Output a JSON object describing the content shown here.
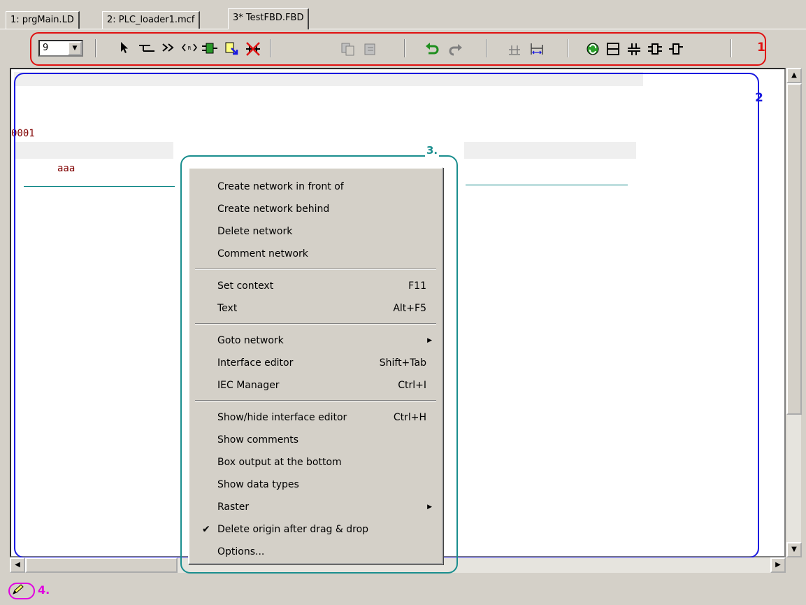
{
  "tabs": [
    {
      "label": "1: prgMain.LD"
    },
    {
      "label": "2: PLC_loader1.mcf"
    },
    {
      "label": "3* TestFBD.FBD"
    }
  ],
  "toolbar": {
    "zoom_value": "9",
    "tools": [
      "pointer-icon",
      "contact-icon",
      "jump-icon",
      "return-icon",
      "function-block-icon",
      "insert-block-icon",
      "delete-connection-icon",
      "copy-network-icon",
      "paste-network-icon",
      "undo-icon",
      "redo-icon",
      "align-icon",
      "distribute-icon",
      "refresh-icon",
      "panel-icon",
      "parallel-icon",
      "block-io-icon",
      "block-out-icon"
    ]
  },
  "editor": {
    "network_number": "0001",
    "variable_name": "aaa"
  },
  "context_menu": {
    "groups": [
      [
        {
          "label": "Create network in front of"
        },
        {
          "label": "Create network behind"
        },
        {
          "label": "Delete network"
        },
        {
          "label": "Comment network"
        }
      ],
      [
        {
          "label": "Set context",
          "shortcut": "F11"
        },
        {
          "label": "Text",
          "shortcut": "Alt+F5"
        }
      ],
      [
        {
          "label": "Goto network",
          "submenu": true
        },
        {
          "label": "Interface editor",
          "shortcut": "Shift+Tab"
        },
        {
          "label": "IEC Manager",
          "shortcut": "Ctrl+I"
        }
      ],
      [
        {
          "label": "Show/hide interface editor",
          "shortcut": "Ctrl+H"
        },
        {
          "label": "Show comments"
        },
        {
          "label": "Box output at the bottom"
        },
        {
          "label": "Show data types"
        },
        {
          "label": "Raster",
          "submenu": true
        },
        {
          "label": "Delete origin after drag & drop",
          "checked": true
        },
        {
          "label": "Options..."
        }
      ]
    ]
  },
  "annotations": {
    "label_1": "1",
    "label_2": "2",
    "label_3": "3.",
    "label_4": "4.",
    "colors": {
      "toolbar": "#e01010",
      "editor": "#1a1ae0",
      "menu": "#1a8e8e",
      "status": "#e000e0"
    }
  },
  "statusbar": {
    "icon": "edit-mode-icon"
  }
}
